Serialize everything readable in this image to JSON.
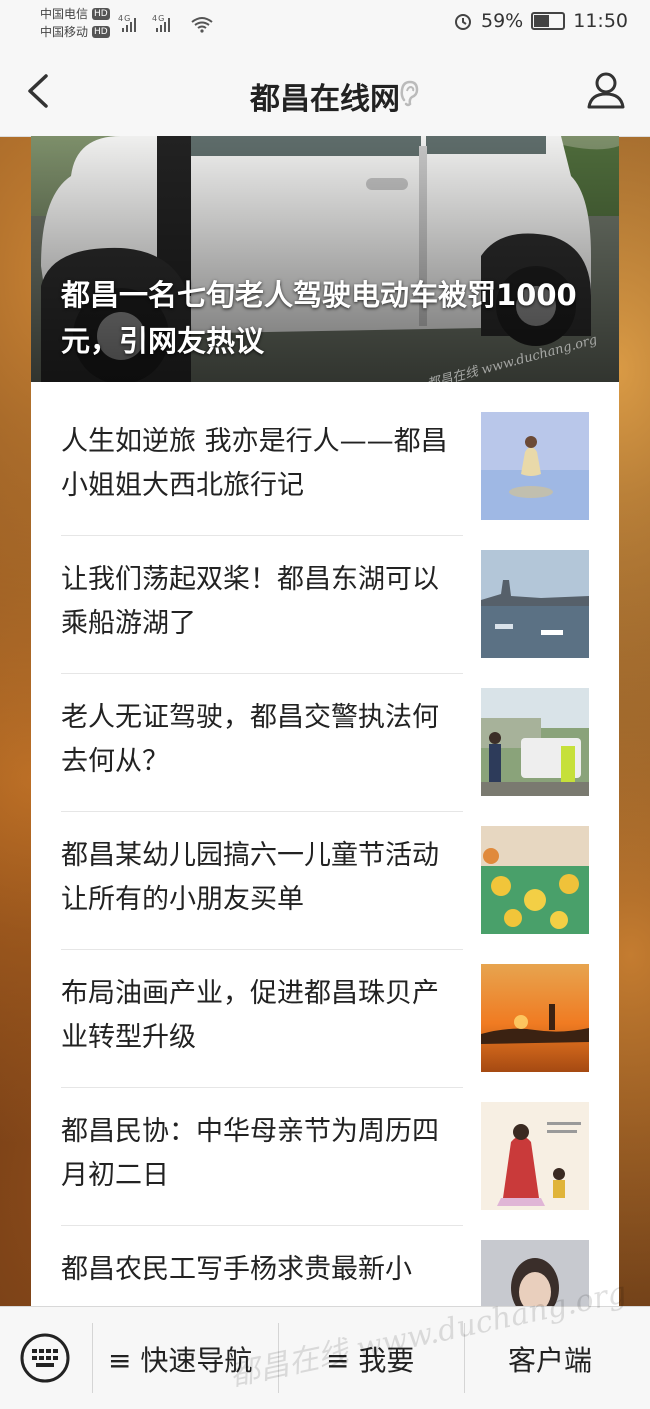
{
  "status_bar": {
    "carrier1": "中国电信",
    "carrier2": "中国移动",
    "hd": "HD",
    "signal": "4G",
    "battery_percent": "59%",
    "battery_level": 0.59,
    "time": "11:50",
    "icons": [
      "signal-icon",
      "wifi-icon",
      "alarm-icon",
      "battery-icon"
    ]
  },
  "header": {
    "title": "都昌在线网",
    "back_icon": "chevron-left-icon",
    "ear_icon": "ear-icon",
    "user_icon": "user-icon"
  },
  "hero": {
    "title": "都昌一名七旬老人驾驶电动车被罚1000元，引网友热议",
    "watermark": "都昌在线 www.duchang.org"
  },
  "news": [
    {
      "title": "人生如逆旅 我亦是行人——都昌小姐姐大西北旅行记",
      "thumb": "woman-salt-lake"
    },
    {
      "title": "让我们荡起双桨！都昌东湖可以乘船游湖了",
      "thumb": "lake-boats"
    },
    {
      "title": "老人无证驾驶，都昌交警执法何去何从？",
      "thumb": "police-scene"
    },
    {
      "title": "都昌某幼儿园搞六一儿童节活动让所有的小朋友买单",
      "thumb": "kids-dancing"
    },
    {
      "title": "布局油画产业，促进都昌珠贝产业转型升级",
      "thumb": "sunset-pagoda"
    },
    {
      "title": "都昌民协：中华母亲节为周历四月初二日",
      "thumb": "mother-illustration"
    },
    {
      "title": "都昌农民工写手杨求贵最新小",
      "thumb": "portrait"
    }
  ],
  "bottom_nav": {
    "keyboard_icon": "keyboard-icon",
    "item1": "≡ 快速导航",
    "item2": "≡ 我要",
    "item3": "客户端",
    "watermark": "都昌在线 www.duchang.org"
  }
}
